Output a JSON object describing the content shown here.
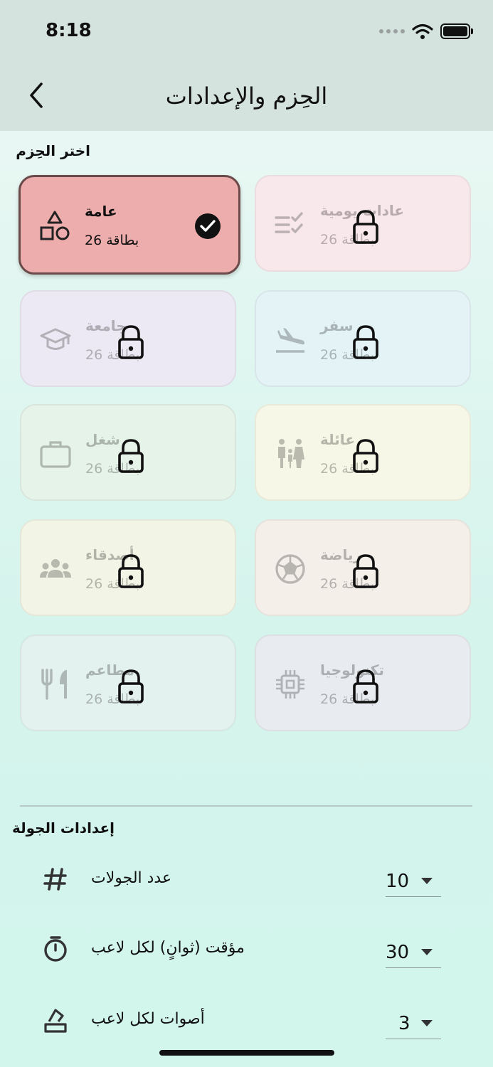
{
  "status": {
    "time": "8:18"
  },
  "header": {
    "title": "الحِزم والإعدادات"
  },
  "packs": {
    "label": "اختر الحِزم",
    "items": [
      {
        "name": "عامة",
        "count": "بطاقة 26",
        "icon": "shapes-icon",
        "selected": true,
        "locked": false,
        "bg": "#eeadad"
      },
      {
        "name": "عادات يومية",
        "count": "بطاقة 26",
        "icon": "checklist-icon",
        "selected": false,
        "locked": true,
        "bg": "#f8e8ec"
      },
      {
        "name": "جامعة",
        "count": "بطاقة 26",
        "icon": "graduation-cap-icon",
        "selected": false,
        "locked": true,
        "bg": "#ede9f4"
      },
      {
        "name": "سفر",
        "count": "بطاقة 26",
        "icon": "airplane-landing-icon",
        "selected": false,
        "locked": true,
        "bg": "#e4f3f6"
      },
      {
        "name": "شغل",
        "count": "بطاقة 26",
        "icon": "briefcase-icon",
        "selected": false,
        "locked": true,
        "bg": "#e6f3e9"
      },
      {
        "name": "عائلة",
        "count": "بطاقة 26",
        "icon": "family-icon",
        "selected": false,
        "locked": true,
        "bg": "#f6f7e6"
      },
      {
        "name": "أصدقاء",
        "count": "بطاقة 26",
        "icon": "group-icon",
        "selected": false,
        "locked": true,
        "bg": "#f2f4e5"
      },
      {
        "name": "رياضة",
        "count": "بطاقة 26",
        "icon": "soccer-ball-icon",
        "selected": false,
        "locked": true,
        "bg": "#f4efe8"
      },
      {
        "name": "مطاعم",
        "count": "بطاقة 26",
        "icon": "utensils-icon",
        "selected": false,
        "locked": true,
        "bg": "#e4f2ef"
      },
      {
        "name": "تكنولوجيا",
        "count": "بطاقة 26",
        "icon": "chip-icon",
        "selected": false,
        "locked": true,
        "bg": "#e8ecf0"
      }
    ]
  },
  "settings": {
    "label": "إعدادات الجولة",
    "rows": [
      {
        "label": "عدد الجولات",
        "value": "10",
        "icon": "hash-icon"
      },
      {
        "label": "مؤقت (ثوانٍ) لكل لاعب",
        "value": "30",
        "icon": "timer-icon"
      },
      {
        "label": "أصوات لكل لاعب",
        "value": "3",
        "icon": "vote-icon"
      }
    ]
  },
  "colors": {
    "selected_border": "#6b4a4a",
    "header_bg": "#d5e3de"
  }
}
